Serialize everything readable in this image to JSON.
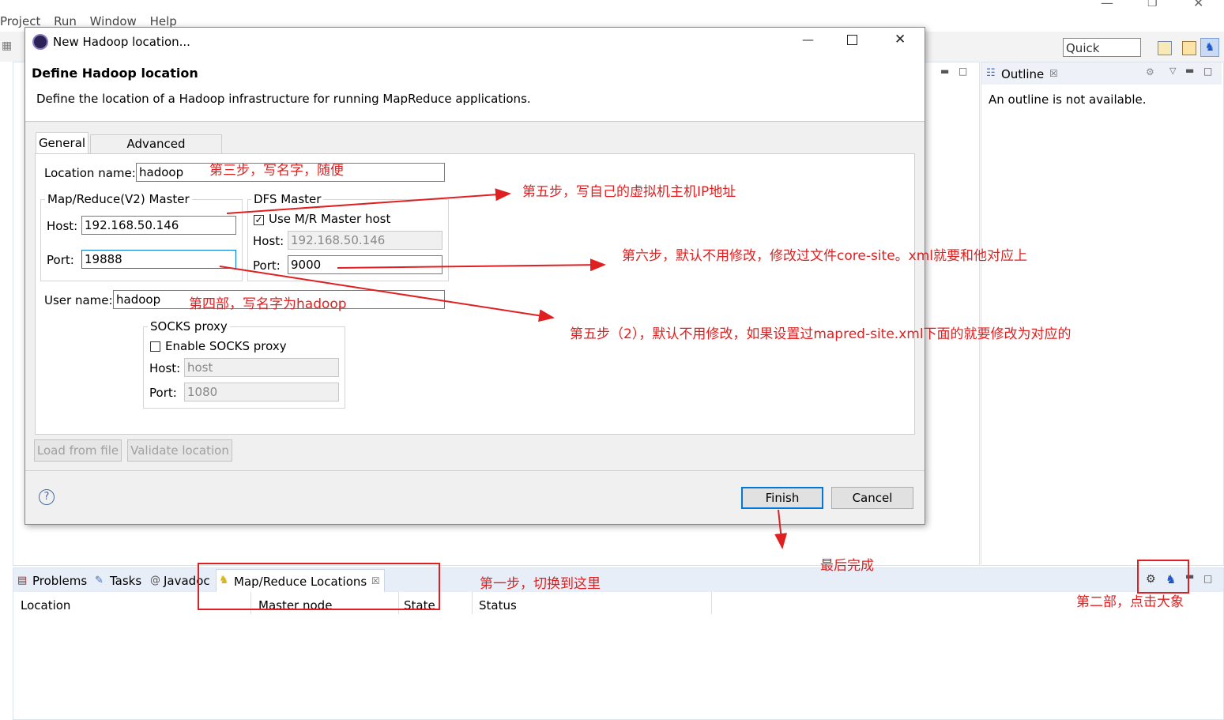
{
  "menu": [
    "Project",
    "Run",
    "Window",
    "Help"
  ],
  "quick_access": "Quick Access",
  "outline": {
    "tab_label": "Outline",
    "message": "An outline is not available."
  },
  "bottom": {
    "tabs": [
      "Problems",
      "Tasks",
      "Javadoc",
      "Map/Reduce Locations"
    ],
    "columns": [
      "Location",
      "Master node",
      "State",
      "Status"
    ]
  },
  "dialog": {
    "window_title": "New Hadoop location...",
    "header_title": "Define Hadoop location",
    "header_desc": "Define the location of a Hadoop infrastructure for running MapReduce applications.",
    "tabs": [
      "General",
      "Advanced parameters"
    ],
    "location_name_label": "Location name:",
    "location_name": "hadoop",
    "mr_group": "Map/Reduce(V2) Master",
    "mr_host_label": "Host:",
    "mr_host": "192.168.50.146",
    "mr_port_label": "Port:",
    "mr_port": "19888",
    "dfs_group": "DFS Master",
    "dfs_use_mr": "Use M/R Master host",
    "dfs_host_label": "Host:",
    "dfs_host": "192.168.50.146",
    "dfs_port_label": "Port:",
    "dfs_port": "9000",
    "user_label": "User name:",
    "user": "hadoop",
    "socks_group": "SOCKS proxy",
    "socks_enable": "Enable SOCKS proxy",
    "socks_host_label": "Host:",
    "socks_host": "host",
    "socks_port_label": "Port:",
    "socks_port": "1080",
    "load_btn": "Load from file",
    "validate_btn": "Validate location",
    "finish_btn": "Finish",
    "cancel_btn": "Cancel"
  },
  "annotations": {
    "step3": "第三步，写名字，随便",
    "step5": "第五步，写自己的虚拟机主机IP地址",
    "step6": "第六步，默认不用修改，修改过文件core-site。xml就要和他对应上",
    "step4": "第四部，写名字为hadoop",
    "step5b": "第五步（2），默认不用修改，如果设置过mapred-site.xml下面的就要修改为对应的",
    "finish": "最后完成",
    "step1": "第一步，切换到这里",
    "step2": "第二部，点击大象"
  },
  "colors": {
    "annotation": "#e02020",
    "default_button": "#0078d7"
  }
}
